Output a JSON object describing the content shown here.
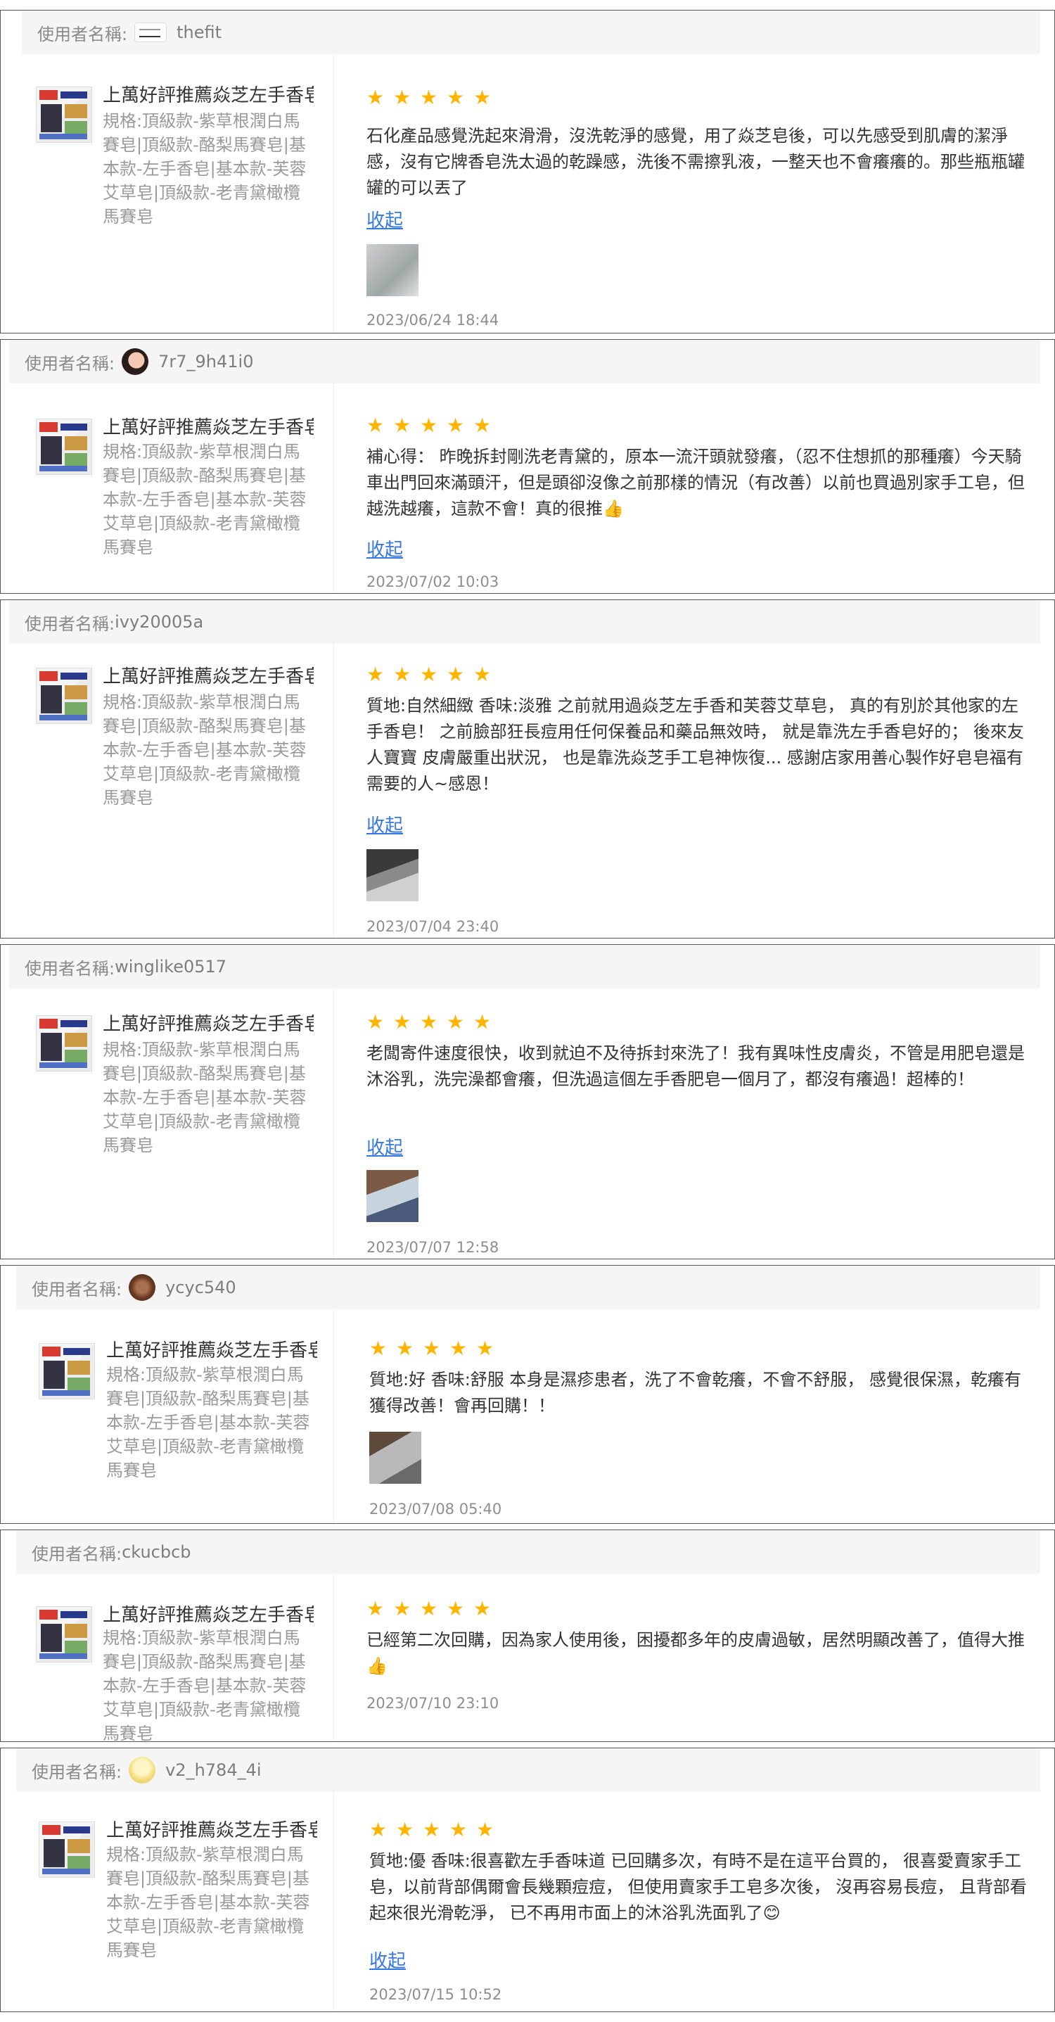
{
  "label": "使用者名稱:",
  "star_char": "★",
  "product": {
    "title": "上萬好評推薦焱芝左手香皂",
    "spec": "規格:頂級款-紫草根潤白馬賽皂|頂級款-酪梨馬賽皂|基本款-左手香皂|基本款-芙蓉艾草皂|頂級款-老青黛橄欖馬賽皂"
  },
  "reviews": [
    {
      "username": "thefit",
      "avatar": "logo-icon",
      "rating": 5,
      "text": "石化產品感覺洗起來滑滑，沒洗乾淨的感覺，用了焱芝皂後，可以先感受到肌膚的潔淨感，沒有它牌香皂洗太過的乾躁感，洗後不需擦乳液，一整天也不會癢癢的。那些瓶瓶罐罐的可以丟了",
      "collapse": "收起",
      "date": "2023/06/24 18:44"
    },
    {
      "username": "7r7_9h41i0",
      "avatar": "face-icon",
      "rating": 5,
      "text": "補心得： 昨晚拆封剛洗老青黛的，原本一流汗頭就發癢，（忍不住想抓的那種癢）今天騎車出門回來滿頭汗，但是頭卻沒像之前那樣的情況（有改善）以前也買過別家手工皂，但越洗越癢，這款不會！真的很推👍",
      "collapse": "收起",
      "date": "2023/07/02 10:03"
    },
    {
      "username": "ivy20005a",
      "avatar": "",
      "rating": 5,
      "text": "質地:自然細緻 香味:淡雅 之前就用過焱芝左手香和芙蓉艾草皂， 真的有別於其他家的左手香皂！ 之前臉部狂長痘用任何保養品和藥品無效時， 就是靠洗左手香皂好的； 後來友人寶寶 皮膚嚴重出狀況， 也是靠洗焱芝手工皂神恢復... 感謝店家用善心製作好皂皂福有需要的人~感恩！",
      "collapse": "收起",
      "date": "2023/07/04 23:40"
    },
    {
      "username": "winglike0517",
      "avatar": "",
      "rating": 5,
      "text": "老闆寄件速度很快，收到就迫不及待拆封來洗了！我有異味性皮膚炎，不管是用肥皂還是沐浴乳，洗完澡都會癢，但洗過這個左手香肥皂一個月了，都沒有癢過！超棒的！",
      "collapse": "收起",
      "date": "2023/07/07 12:58"
    },
    {
      "username": "ycyc540",
      "avatar": "food-icon",
      "rating": 5,
      "text": "質地:好 香味:舒服 本身是濕疹患者，洗了不會乾癢，不會不舒服， 感覺很保濕，乾癢有獲得改善！會再回購！！",
      "collapse": "",
      "date": "2023/07/08 05:40"
    },
    {
      "username": "ckucbcb",
      "avatar": "",
      "rating": 5,
      "text": "已經第二次回購，因為家人使用後，困擾都多年的皮膚過敏，居然明顯改善了，值得大推👍",
      "collapse": "",
      "date": "2023/07/10 23:10"
    },
    {
      "username": "v2_h784_4i",
      "avatar": "cup-icon",
      "rating": 5,
      "text": "質地:優 香味:很喜歡左手香味道 已回購多次，有時不是在這平台買的， 很喜愛賣家手工皂，以前背部偶爾會長幾顆痘痘， 但使用賣家手工皂多次後， 沒再容易長痘， 且背部看起來很光滑乾淨， 已不再用市面上的沐浴乳洗面乳了😊",
      "collapse": "收起",
      "date": "2023/07/15 10:52"
    }
  ]
}
